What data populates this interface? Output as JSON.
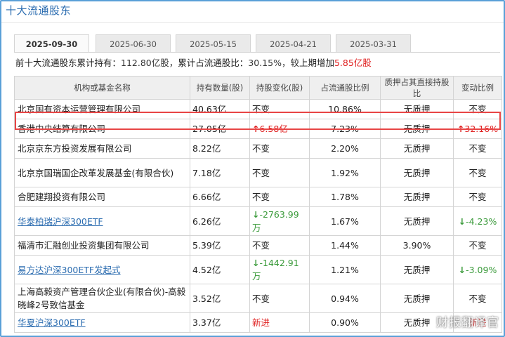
{
  "panel": {
    "title": "十大流通股东"
  },
  "tabs": [
    "2025-09-30",
    "2025-06-30",
    "2025-05-15",
    "2025-04-21",
    "2025-03-31"
  ],
  "summary": {
    "prefix": "前十大流通股东累计持有：",
    "total_held": "112.80亿股",
    "mid": "，累计占流通股比：",
    "ratio": "30.15%",
    "suffix": "，较上期增加",
    "increase": "5.85亿股"
  },
  "table": {
    "headers": [
      "机构或基金名称",
      "持有数量(股)",
      "持股变化(股)",
      "占流通股比例",
      "质押占其直接持股比",
      "变动比例"
    ],
    "rows": [
      {
        "name": "北京国有资本运营管理有限公司",
        "amount": "40.63亿",
        "change": "不变",
        "change_dir": "",
        "ratio": "10.86%",
        "pledge": "无质押",
        "pct": "不变",
        "pct_dir": "",
        "link": false
      },
      {
        "name": "香港中央结算有限公司",
        "amount": "27.05亿",
        "change": "6.58亿",
        "change_dir": "up",
        "ratio": "7.23%",
        "pledge": "无质押",
        "pct": "32.16%",
        "pct_dir": "up",
        "link": false
      },
      {
        "name": "北京京东方投资发展有限公司",
        "amount": "8.22亿",
        "change": "不变",
        "change_dir": "",
        "ratio": "2.20%",
        "pledge": "无质押",
        "pct": "不变",
        "pct_dir": "",
        "link": false
      },
      {
        "name": "北京京国瑞国企改革发展基金(有限合伙)",
        "amount": "7.18亿",
        "change": "不变",
        "change_dir": "",
        "ratio": "1.92%",
        "pledge": "无质押",
        "pct": "不变",
        "pct_dir": "",
        "link": false
      },
      {
        "name": "合肥建翔投资有限公司",
        "amount": "6.66亿",
        "change": "不变",
        "change_dir": "",
        "ratio": "1.78%",
        "pledge": "无质押",
        "pct": "不变",
        "pct_dir": "",
        "link": false
      },
      {
        "name": "华泰柏瑞沪深300ETF",
        "amount": "6.26亿",
        "change": "-2763.99万",
        "change_dir": "down",
        "ratio": "1.67%",
        "pledge": "无质押",
        "pct": "-4.23%",
        "pct_dir": "down",
        "link": true
      },
      {
        "name": "福清市汇融创业投资集团有限公司",
        "amount": "5.39亿",
        "change": "不变",
        "change_dir": "",
        "ratio": "1.44%",
        "pledge": "3.90%",
        "pct": "不变",
        "pct_dir": "",
        "link": false
      },
      {
        "name": "易方达沪深300ETF发起式",
        "amount": "4.52亿",
        "change": "-1442.91万",
        "change_dir": "down",
        "ratio": "1.21%",
        "pledge": "无质押",
        "pct": "-3.09%",
        "pct_dir": "down",
        "link": true
      },
      {
        "name": "上海高毅资产管理合伙企业(有限合伙)-高毅晓峰2号致信基金",
        "amount": "3.52亿",
        "change": "不变",
        "change_dir": "",
        "ratio": "0.94%",
        "pledge": "无质押",
        "pct": "不变",
        "pct_dir": "",
        "link": false
      },
      {
        "name": "华夏沪深300ETF",
        "amount": "3.37亿",
        "change": "新进",
        "change_dir": "new",
        "ratio": "0.90%",
        "pledge": "无质押",
        "pct": "新进",
        "pct_dir": "new",
        "link": true
      }
    ]
  },
  "watermark": "财报翻译官",
  "colors": {
    "accent": "#2b6cb0",
    "up": "#e02020",
    "down": "#3a9a3a",
    "highlight": "#e84545"
  }
}
